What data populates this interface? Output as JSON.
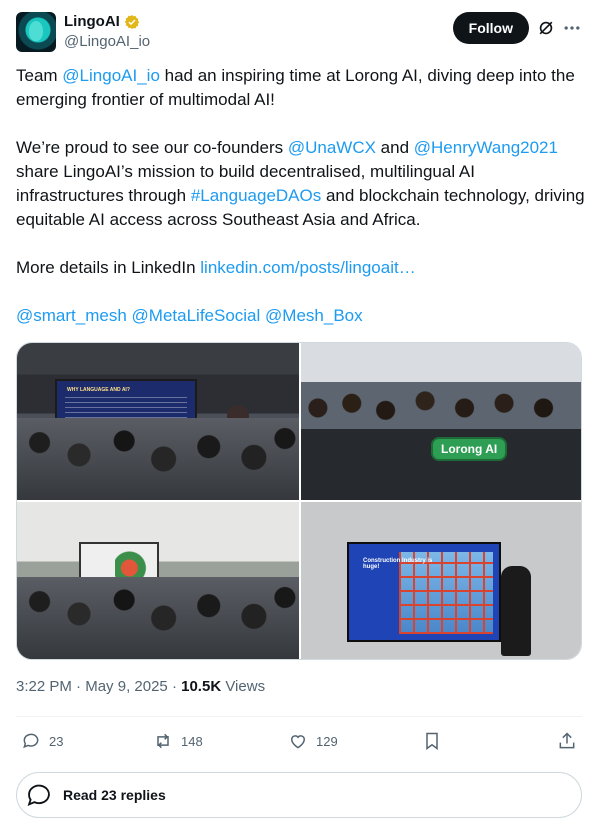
{
  "author": {
    "display_name": "LingoAI",
    "handle": "@LingoAI_io",
    "verified_color": "#e2b719"
  },
  "header": {
    "follow_label": "Follow"
  },
  "tweet": {
    "p1_prefix": "Team ",
    "p1_mention": "@LingoAI_io",
    "p1_suffix": " had an inspiring time at Lorong AI, diving deep into the emerging frontier of multimodal AI!",
    "p2_prefix": "We’re proud to see our co-founders ",
    "p2_mention1": "@UnaWCX",
    "p2_and": " and ",
    "p2_mention2": "@HenryWang2021",
    "p2_mid": " share LingoAI’s mission to build decentralised, multilingual AI infrastructures through ",
    "p2_hashtag": "#LanguageDAOs",
    "p2_suffix": " and blockchain technology, driving equitable AI access across Southeast Asia and Africa.",
    "p3_prefix": "More details in LinkedIn ",
    "p3_link": "linkedin.com/posts/lingoait…",
    "p4_mention1": "@smart_mesh",
    "p4_mention2": "@MetaLifeSocial",
    "p4_mention3": "@Mesh_Box"
  },
  "media": {
    "photo1_screen_title": "WHY LANGUAGE AND AI?",
    "photo2_sign": "Lorong AI",
    "photo4_screen_title": "Construction Industry is huge!"
  },
  "meta": {
    "time": "3:22 PM",
    "sep1": " · ",
    "date": "May 9, 2025",
    "sep2": " · ",
    "views_count": "10.5K",
    "views_label": " Views"
  },
  "actions": {
    "replies": "23",
    "reposts": "148",
    "likes": "129"
  },
  "read_replies_label": "Read 23 replies",
  "colors": {
    "link": "#1d9bf0",
    "text": "#0f1419",
    "secondary": "#536471"
  }
}
